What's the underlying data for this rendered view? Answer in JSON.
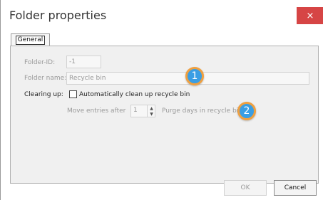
{
  "window": {
    "title": "Folder properties",
    "close_label": "×"
  },
  "tabs": [
    {
      "label": "General"
    }
  ],
  "form": {
    "folder_id_label": "Folder-ID:",
    "folder_id_value": "-1",
    "folder_name_label": "Folder name:",
    "folder_name_value": "Recycle bin",
    "clearing_up_label": "Clearing up:",
    "auto_clean_label": "Automatically clean up recycle bin",
    "auto_clean_checked": false,
    "move_entries_label": "Move entries after",
    "purge_days_value": "1",
    "purge_days_suffix": "Purge days in recycle bin"
  },
  "annotations": [
    {
      "number": "1"
    },
    {
      "number": "2"
    }
  ],
  "buttons": {
    "ok_label": "OK",
    "cancel_label": "Cancel"
  },
  "colors": {
    "close_button": "#d64545",
    "badge_fill": "#3a9ee4",
    "badge_border": "#f0a040"
  }
}
